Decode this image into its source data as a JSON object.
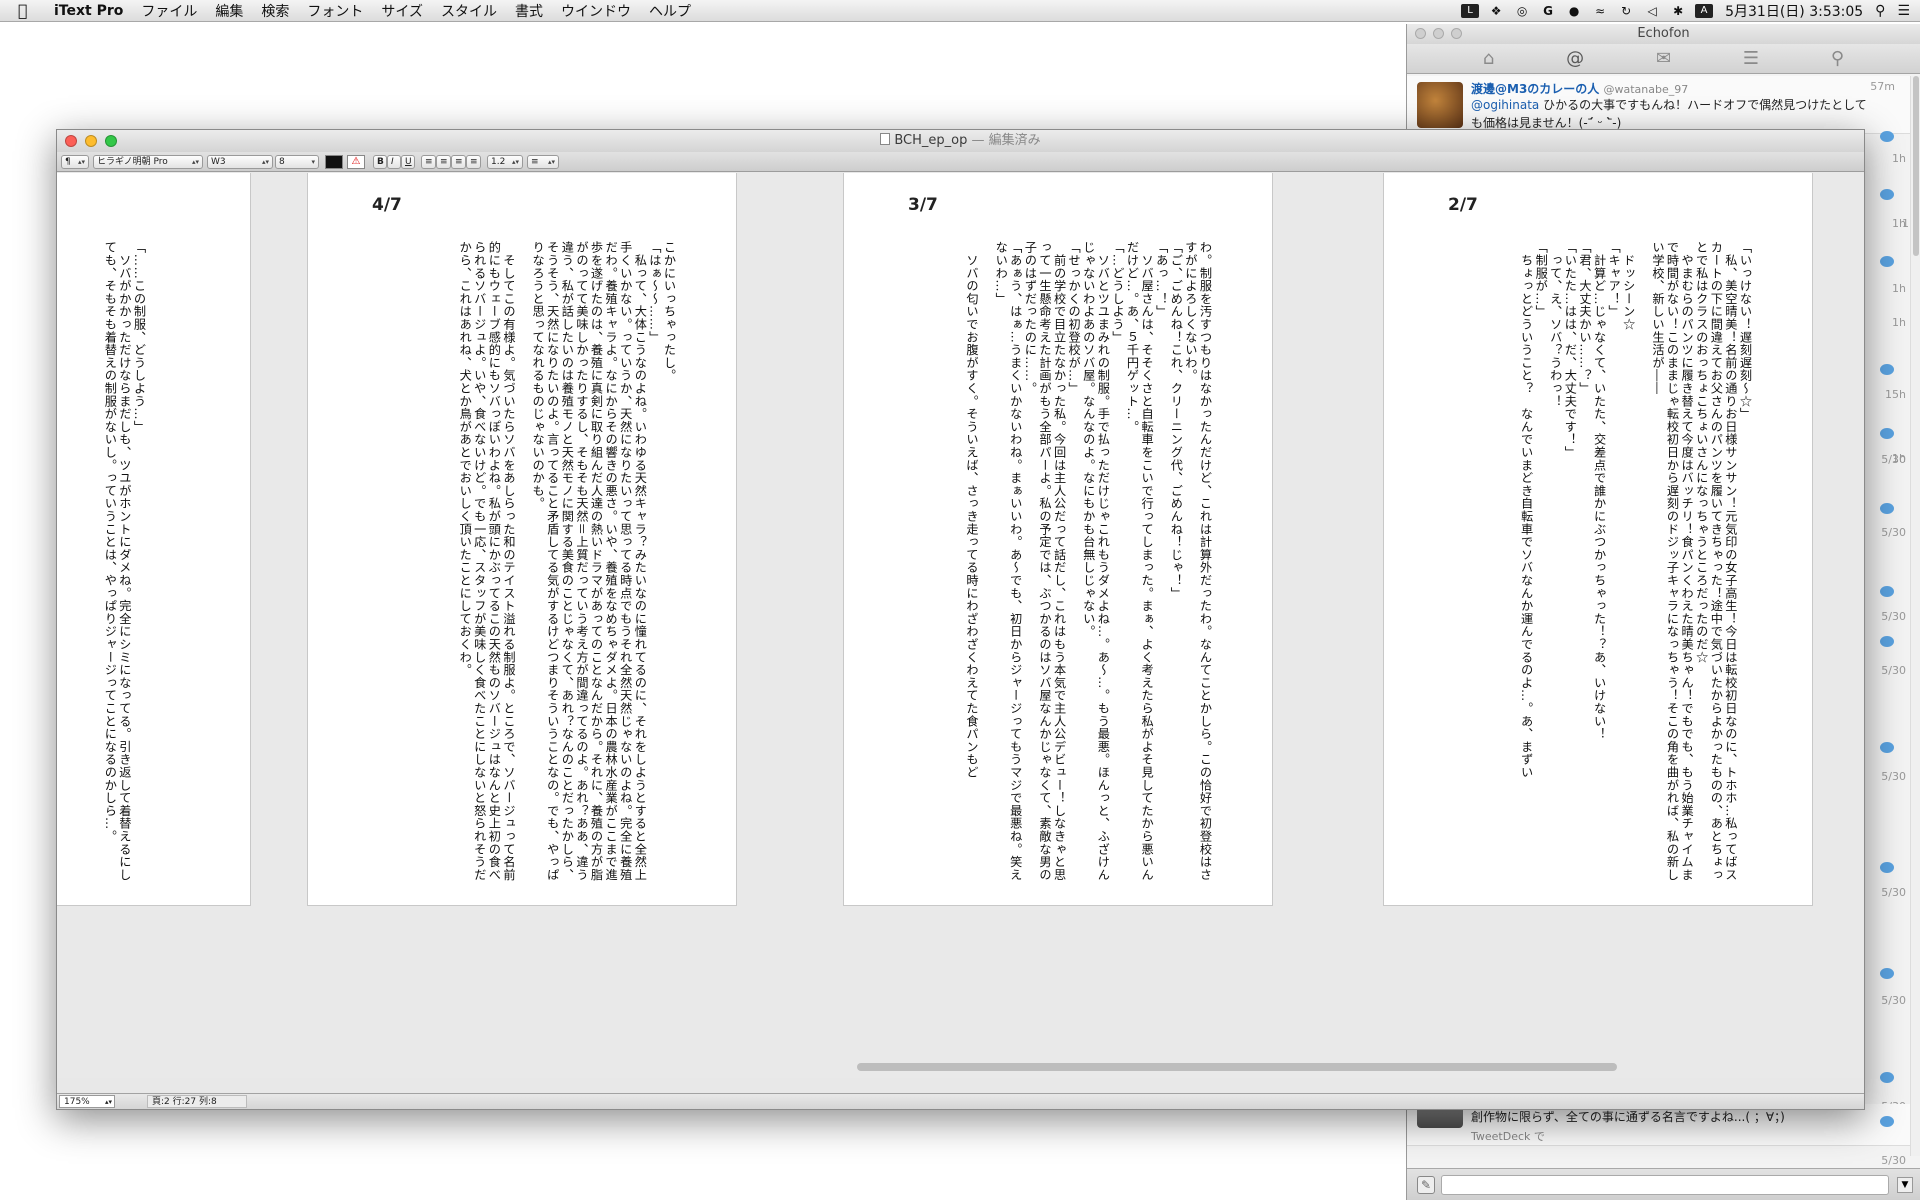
{
  "menubar": {
    "app_name": "iText Pro",
    "items": [
      "ファイル",
      "編集",
      "検索",
      "フォント",
      "サイズ",
      "スタイル",
      "書式",
      "ウインドウ",
      "ヘルプ"
    ],
    "status_icons": [
      "line-icon",
      "dropbox-icon",
      "cc-icon",
      "google-icon",
      "record-icon",
      "wifi-icon",
      "timemachine-icon",
      "volume-icon",
      "bluetooth-icon",
      "input-a-icon"
    ],
    "input_label": "A",
    "clock": "5月31日(日) 3:53:05"
  },
  "echofon": {
    "title": "Echofon",
    "tabs": [
      "home-icon",
      "mention-icon",
      "mail-icon",
      "list-icon",
      "search-icon"
    ],
    "tweets": [
      {
        "name": "渡邊@M3のカレーの人",
        "handle": "@watanabe_97",
        "time": "57m",
        "mention": "@ogihinata",
        "text": " ひかるの大事ですもんね！ハードオフで偶然見つけたとしても価格は見ません！(-ˊ᷄ ᵕ ˋ᷅-)"
      }
    ],
    "bottom_tweet": {
      "text": "創作物に限らず、全ての事に通ずる名言ですよね...( ；∀；)",
      "via": "TweetDeck で"
    },
    "side_times": [
      "1h",
      "1h",
      "1h",
      "1h",
      "1h",
      "15h",
      "1h",
      "5/30",
      "5/30",
      "5/30",
      "5/30",
      "5/30",
      "5/30",
      "5/30",
      "5/30",
      "5/30",
      "5/30"
    ]
  },
  "itext": {
    "title": "BCH_ep_op",
    "title_suffix": " — 編集済み",
    "toolbar": {
      "paragraph": "¶",
      "font": "ヒラギノ明朝 Pro",
      "weight": "W3",
      "size": "8",
      "bold": "B",
      "italic": "I",
      "underline": "U",
      "line_spacing": "1.2"
    },
    "status": {
      "zoom": "175%",
      "position": "頁:2  行:27  列:8"
    },
    "pages": [
      {
        "num": "2/7",
        "text": "「いっけない！遅刻遅刻〜☆」\n　私、美空晴美！名前の通りお日様サンサン！元気印の女子高生！今日は転校初日なのに、トホホ…私ってばスカートの下に間違えてお父さんのパンツを履いてきちゃった！途中で気づいたからよかったものの、あとちょっとで私はクラスのおっちょこちょいさんになっちゃうところだったのだ☆\n　やまむらのパンツに履き替えて今度はバッチリ！食パンくわえた晴美ちゃん！でもでも、もう始業チャイムまで時間がない！このままじゃ転校初日から遅刻のドジッ子キャラになっちゃう！そこの角を曲がれば、私の新しい学校、新しい生活が――\n\n　ドッシーン☆\n「キャア！」\n　計算ど…じゃなくて、いたた、交差点で誰かにぶつかっちゃった！？あ、いけない！\n「君、大丈夫かい……？」\n「いたた…はは、だ、大丈夫です！」\n　って、え、ソバ？うわっ！\n「制服が…」\n　ちょっとどういうこと？　なんでいまどき自転車でソバなんか運んでるのよ…。あ、まずい"
      },
      {
        "num": "3/7",
        "text": "わ。制服を汚すつもりはなかったんだけど、これは計算外だったわ。なんてことかしら。この恰好で初登校はさすがによろしくないわ。\n「ご、ごめんね！これ、クリーニング代、ごめんね！じゃ！」\n「あっ…！」\n　ソバ屋さんは、そそくさと自転車をこいで行ってしまった。まぁ、よく考えたら私がよそ見してたから悪いんだけど…。あ、５千円ゲット…。\n「…どうしよう」\n　ソバとツユまみれの制服。手で払っただけじゃこれもうダメよね…。あ〜…。もう最悪。ほんっと、ふざけんじゃないわよあのソバ屋。なんなのよ。なにもかも台無しじゃない。\n「せっかくの初登校が…」\n　前の学校で目立たなかった私。今回は主人公だって話だし、これはもう本気で主人公デビュー！しなきゃと思って一生懸命考えた計画がもう全部パーよ。私の予定では、ぶつかるのはソバ屋なんかじゃなくて、素敵な男の子のはずだったのに……。\n「あぁう、はぁ…うまくいかないわね。まぁいいわ。あ〜でも、初日からジャージってもうマジで最悪ね。笑えないわ…」\n\n　ソバの匂いでお腹がすく。そういえば、さっき走ってる時にわざわざくわえてた食パンもど"
      },
      {
        "num": "4/7",
        "text": "こかにいっちゃったし。\n「はぁ〜〜……」\n　私って、大体こうなのよね。いわゆる天然キャラ？みたいなのに憧れてるのに、それをしようとすると全然上手くいかない。っていうか、天然になりたいって思ってる時点でもうそれ全然天然じゃないのよね。完全に養殖だわ。養殖キャラよ。なにからその響きの悪さ。いや、養殖をなめちゃダメよ。日本の農林水産業がここまで進歩を遂げたのは、養殖に真剣に取り組んだ人達の熱いドラマがあってのことなんだから。それに、養殖の方が脂がのってて美味しかったりするし、そもそも天然＝上質だっていう考え方が間違ってるのよ。あれ？ああ、違う違う、私が話したいのは養殖モノと天然モノに関する美食のことじゃなくて、あれ？なんのことだったかしら、そうそう、天然になりたいのよ。言ってること矛盾してる気がするけどつまりそういうことなの。でも、やっぱりなろうと思ってなれるものじゃないのかも。\n\n　そしてこの有様よ。気づいたらソバをあしらった和のテイスト溢れる制服よ。ところで、ソバージュって名前的にもウェーブ感的にもソバっぽいわよね。私が頭にかぶってるこの天然ものソバージュはなんと史上初の食べられるソバージュよ。いや、食べないけど。でも一応、スタッフが美味しく食べたことにしないと怒られそうだから、これはあれね、犬とか鳥があとでおいしく頂いたことにしておくわ。"
      },
      {
        "num": "",
        "text": "「……この制服、どうしよう…」\n　ソバがかかっただけならまだしも、ツユがホントにダメね。完全にシミになってる。引き返して着替えるにしても、そもそも着替えの制服がないし。っていうことは、やっぱりジャージってことになるのかしら…。"
      }
    ]
  }
}
